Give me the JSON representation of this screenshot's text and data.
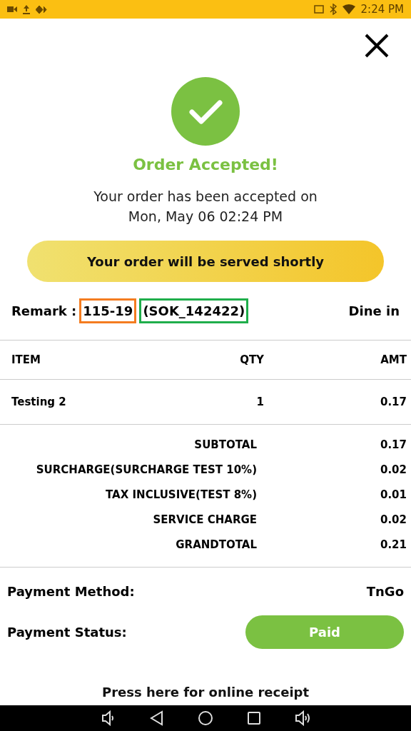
{
  "status_bar": {
    "time": "2:24 PM"
  },
  "title": "Order Accepted!",
  "message": [
    "Your order has been accepted on",
    "Mon, May 06 02:24 PM"
  ],
  "banner": "Your order will be served shortly",
  "remark": {
    "label": "Remark :",
    "parts": [
      {
        "text": "115-19",
        "color": "#f47c20"
      },
      {
        "text": "(SOK_142422)",
        "color": "#1fae4b"
      }
    ],
    "type": "Dine in"
  },
  "table": {
    "columns": [
      "ITEM",
      "QTY",
      "AMT"
    ],
    "rows": [
      [
        "Testing 2",
        "1",
        "0.17"
      ]
    ]
  },
  "totals": [
    {
      "label": "SUBTOTAL",
      "value": "0.17"
    },
    {
      "label": "SURCHARGE(SURCHARGE TEST 10%)",
      "value": "0.02"
    },
    {
      "label": "TAX INCLUSIVE(TEST 8%)",
      "value": "0.01"
    },
    {
      "label": "SERVICE CHARGE",
      "value": "0.02"
    },
    {
      "label": "GRANDTOTAL",
      "value": "0.21"
    }
  ],
  "payment_method": {
    "label": "Payment Method:",
    "value": "TnGo"
  },
  "payment_status": {
    "label": "Payment Status:",
    "value": "Paid"
  },
  "receipt_link": "Press here for online receipt"
}
